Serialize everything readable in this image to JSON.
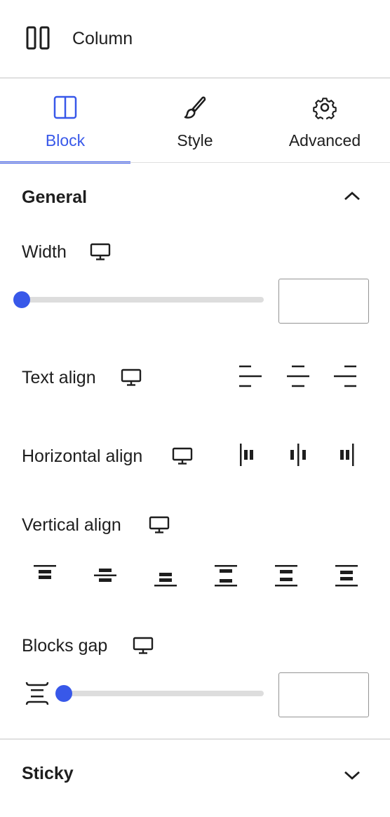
{
  "header": {
    "title": "Column",
    "icon": "columns-icon"
  },
  "tabs": [
    {
      "label": "Block",
      "icon": "block-icon",
      "active": true
    },
    {
      "label": "Style",
      "icon": "brush-icon",
      "active": false
    },
    {
      "label": "Advanced",
      "icon": "gear-icon",
      "active": false
    }
  ],
  "general": {
    "title": "General",
    "expanded": true,
    "width": {
      "label": "Width",
      "device": "desktop",
      "value": "",
      "slider_fraction": 0
    },
    "text_align": {
      "label": "Text align",
      "device": "desktop",
      "options": [
        "left",
        "center",
        "right"
      ]
    },
    "horizontal_align": {
      "label": "Horizontal align",
      "device": "desktop",
      "options": [
        "start",
        "center",
        "end"
      ]
    },
    "vertical_align": {
      "label": "Vertical align",
      "device": "desktop",
      "options": [
        "top",
        "center",
        "bottom",
        "space-between",
        "space-around",
        "space-evenly"
      ]
    },
    "blocks_gap": {
      "label": "Blocks gap",
      "device": "desktop",
      "value": "",
      "slider_fraction": 0
    }
  },
  "sticky": {
    "title": "Sticky",
    "expanded": false
  },
  "colors": {
    "accent": "#3858e9",
    "text": "#1e1e1e",
    "divider": "#e0e0e0",
    "track": "#dddddd"
  }
}
